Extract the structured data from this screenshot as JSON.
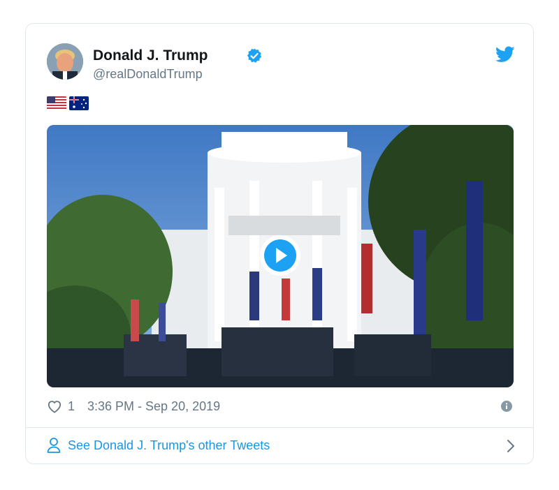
{
  "author": {
    "display_name": "Donald J. Trump",
    "handle": "@realDonaldTrump",
    "verified": true
  },
  "tweet": {
    "flags": [
      "united-states-flag",
      "australia-flag"
    ],
    "media": {
      "type": "video",
      "icon": "play-icon"
    },
    "likes": "1",
    "timestamp": "3:36 PM - Sep 20, 2019"
  },
  "footer": {
    "label": "See Donald J. Trump's other Tweets",
    "icon": "person-icon"
  },
  "colors": {
    "twitter_blue": "#1da1f2",
    "link_blue": "#1b95e0",
    "secondary_text": "#657786",
    "primary_text": "#14171a",
    "border": "#e1e8ed"
  }
}
